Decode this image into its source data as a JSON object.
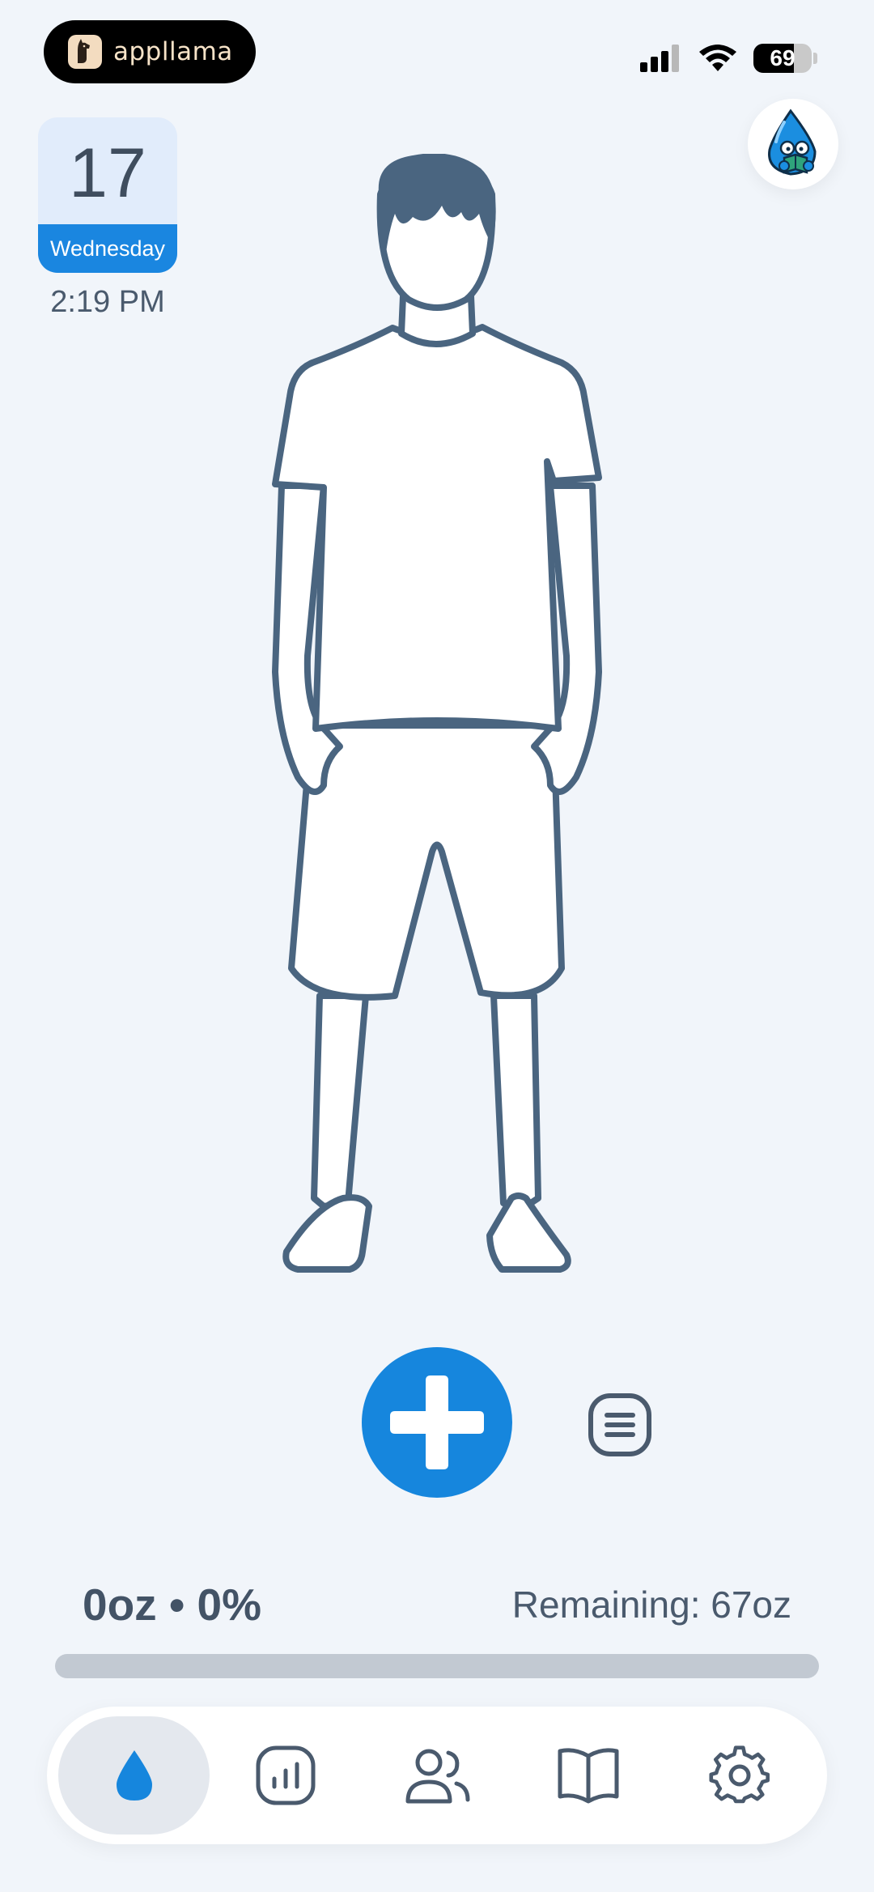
{
  "status_bar": {
    "app_name": "appllama",
    "battery_level": "69",
    "battery_fraction": 0.69
  },
  "date_card": {
    "day": "17",
    "weekday": "Wednesday",
    "time": "2:19 PM"
  },
  "profile": {
    "icon": "water-drop-reading-mascot-icon"
  },
  "actions": {
    "add_icon": "plus-icon",
    "log_icon": "list-icon"
  },
  "progress": {
    "intake_label": "0oz • 0%",
    "remaining_label": "Remaining: 67oz",
    "fraction": 0
  },
  "tabs": [
    {
      "icon": "water-drop-icon",
      "active": true
    },
    {
      "icon": "bar-chart-icon",
      "active": false
    },
    {
      "icon": "people-icon",
      "active": false
    },
    {
      "icon": "book-icon",
      "active": false
    },
    {
      "icon": "gear-icon",
      "active": false
    }
  ],
  "colors": {
    "background": "#f1f5fa",
    "accent": "#1686dd",
    "text": "#4a5a6d",
    "track": "#c2c9d2"
  }
}
